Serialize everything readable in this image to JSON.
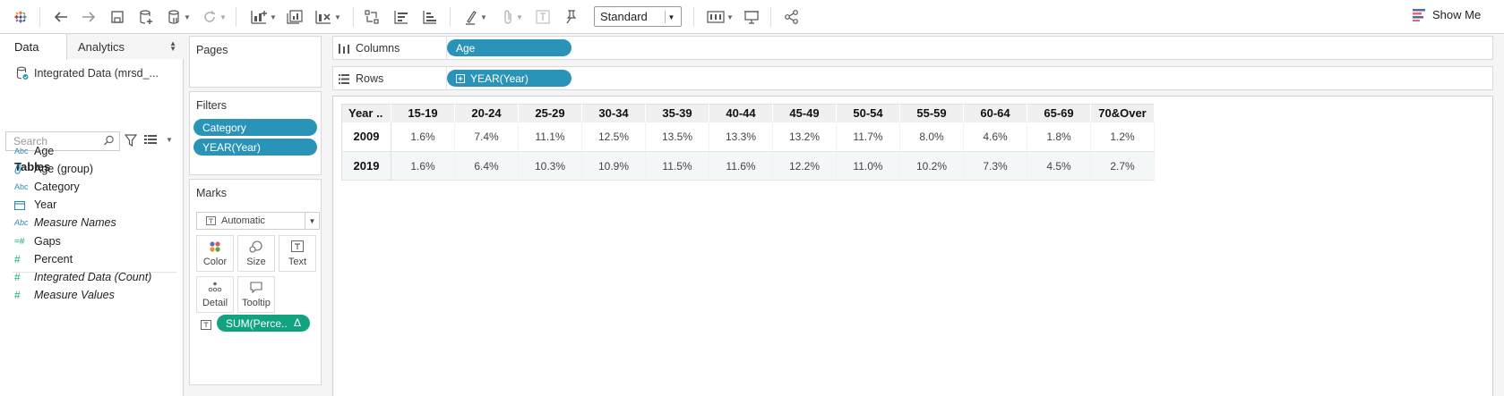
{
  "toolbar": {
    "standard_label": "Standard",
    "show_me_label": "Show Me"
  },
  "data_pane": {
    "tabs": [
      "Data",
      "Analytics"
    ],
    "datasource": "Integrated Data (mrsd_...",
    "search_placeholder": "Search",
    "tables_title": "Tables",
    "dimensions": [
      {
        "icon": "Abc",
        "label": "Age",
        "italic": false
      },
      {
        "icon": "paperclip",
        "label": "Age (group)",
        "italic": false
      },
      {
        "icon": "Abc",
        "label": "Category",
        "italic": false
      },
      {
        "icon": "calendar",
        "label": "Year",
        "italic": false
      },
      {
        "icon": "Abc",
        "label": "Measure Names",
        "italic": true
      }
    ],
    "measures": [
      {
        "icon": "=#",
        "label": "Gaps",
        "italic": false
      },
      {
        "icon": "#",
        "label": "Percent",
        "italic": false
      },
      {
        "icon": "#",
        "label": "Integrated Data (Count)",
        "italic": true
      },
      {
        "icon": "#",
        "label": "Measure Values",
        "italic": true
      }
    ]
  },
  "pages": {
    "title": "Pages"
  },
  "filters": {
    "title": "Filters",
    "items": [
      "Category",
      "YEAR(Year)"
    ]
  },
  "marks": {
    "title": "Marks",
    "type": "Automatic",
    "buttons": [
      "Color",
      "Size",
      "Text",
      "Detail",
      "Tooltip"
    ],
    "pill": "SUM(Perce..",
    "pill_delta": "Δ"
  },
  "shelves": {
    "columns_label": "Columns",
    "columns_pill": "Age",
    "rows_label": "Rows",
    "rows_pill": "YEAR(Year)"
  },
  "crosstab": {
    "corner": "Year ..",
    "columns": [
      "15-19",
      "20-24",
      "25-29",
      "30-34",
      "35-39",
      "40-44",
      "45-49",
      "50-54",
      "55-59",
      "60-64",
      "65-69",
      "70&Over"
    ],
    "rows": [
      {
        "year": "2009",
        "values": [
          "1.6%",
          "7.4%",
          "11.1%",
          "12.5%",
          "13.5%",
          "13.3%",
          "13.2%",
          "11.7%",
          "8.0%",
          "4.6%",
          "1.8%",
          "1.2%"
        ]
      },
      {
        "year": "2019",
        "values": [
          "1.6%",
          "6.4%",
          "10.3%",
          "10.9%",
          "11.5%",
          "11.6%",
          "12.2%",
          "11.0%",
          "10.2%",
          "7.3%",
          "4.5%",
          "2.7%"
        ]
      }
    ]
  }
}
